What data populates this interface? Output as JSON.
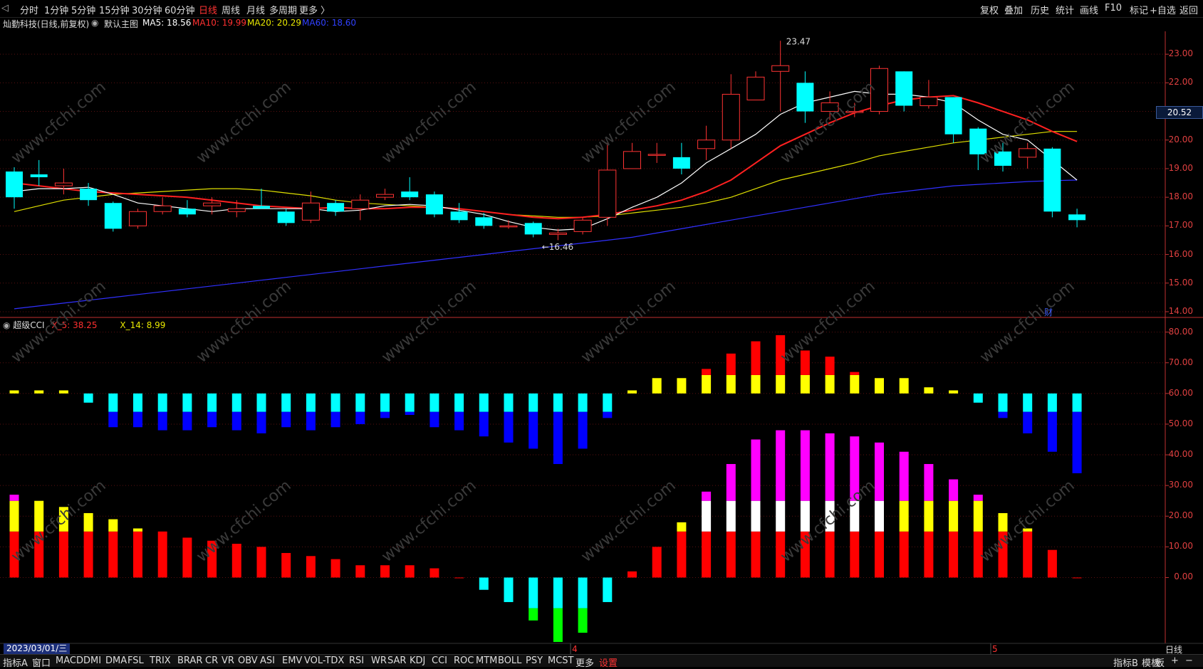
{
  "toolbar": {
    "periods": [
      "分时",
      "1分钟",
      "5分钟",
      "15分钟",
      "30分钟",
      "60分钟",
      "日线",
      "周线",
      "月线",
      "多周期",
      "更多 〉"
    ],
    "active_period": "日线",
    "right_buttons": [
      "复权",
      "叠加",
      "历史",
      "统计",
      "画线",
      "F10",
      "标记",
      "+自选",
      "返回"
    ]
  },
  "main_title": {
    "stock": "灿勤科技(日线,前复权)",
    "template": "默认主图",
    "ma5": "MA5: 18.56",
    "ma10": "MA10: 19.99",
    "ma20": "MA20: 20.29",
    "ma60": "MA60: 18.60"
  },
  "colors": {
    "up": "#ff3333",
    "down": "#00ffff",
    "ma5": "#ffffff",
    "ma10": "#ff2020",
    "ma20": "#e0e000",
    "ma60": "#3030ff",
    "axis": "#c03030",
    "grid": "#5a1010",
    "cci_red": "#ff0000",
    "cci_yellow": "#ffff00",
    "cci_magenta": "#ff00ff",
    "cci_white": "#ffffff",
    "cci_cyan": "#00ffff",
    "cci_green": "#00ff00",
    "cci_blue": "#0000ff"
  },
  "chart_data": [
    {
      "type": "candlestick",
      "title": "灿勤科技(日线,前复权)",
      "ylim": [
        13.8,
        23.8
      ],
      "yticks": [
        "23.00",
        "22.00",
        "21.00",
        "20.00",
        "19.00",
        "18.00",
        "17.00",
        "16.00",
        "15.00",
        "14.00"
      ],
      "ytick_values": [
        23,
        22,
        21,
        20,
        19,
        18,
        17,
        16,
        15,
        14
      ],
      "current_price": "20.52",
      "annotations": {
        "high": "23.47",
        "low": "16.46"
      },
      "candles": [
        [
          18.9,
          18.0,
          19.05,
          17.6
        ],
        [
          18.8,
          18.7,
          19.3,
          18.4
        ],
        [
          18.4,
          18.5,
          19.0,
          18.1
        ],
        [
          18.3,
          17.9,
          18.5,
          17.7
        ],
        [
          17.8,
          16.9,
          17.85,
          16.8
        ],
        [
          17.0,
          17.5,
          17.6,
          16.9
        ],
        [
          17.5,
          17.7,
          18.0,
          17.4
        ],
        [
          17.6,
          17.4,
          17.9,
          17.3
        ],
        [
          17.7,
          17.8,
          18.0,
          17.4
        ],
        [
          17.5,
          17.6,
          17.9,
          17.3
        ],
        [
          17.7,
          17.6,
          18.3,
          17.6
        ],
        [
          17.5,
          17.1,
          17.6,
          17.0
        ],
        [
          17.2,
          17.8,
          18.2,
          17.1
        ],
        [
          17.8,
          17.5,
          17.9,
          17.35
        ],
        [
          17.6,
          17.9,
          18.1,
          17.2
        ],
        [
          18.0,
          18.1,
          18.3,
          17.9
        ],
        [
          18.2,
          18.0,
          18.7,
          17.9
        ],
        [
          18.1,
          17.4,
          18.2,
          17.3
        ],
        [
          17.5,
          17.2,
          17.8,
          17.1
        ],
        [
          17.3,
          17.0,
          17.45,
          16.9
        ],
        [
          17.0,
          17.0,
          17.2,
          16.9
        ],
        [
          17.1,
          16.7,
          17.15,
          16.6
        ],
        [
          16.7,
          16.75,
          16.9,
          16.5
        ],
        [
          16.8,
          17.2,
          17.3,
          16.7
        ],
        [
          17.3,
          18.95,
          19.9,
          17.0
        ],
        [
          19.0,
          19.6,
          19.9,
          19.0
        ],
        [
          19.5,
          19.5,
          19.9,
          19.2
        ],
        [
          19.4,
          19.0,
          19.9,
          18.8
        ],
        [
          19.7,
          20.0,
          20.5,
          19.3
        ],
        [
          20.0,
          21.6,
          22.3,
          19.7
        ],
        [
          21.4,
          22.2,
          22.4,
          21.4
        ],
        [
          22.4,
          22.6,
          23.47,
          21.0
        ],
        [
          22.0,
          21.0,
          22.4,
          20.6
        ],
        [
          21.0,
          21.3,
          21.7,
          20.7
        ],
        [
          21.0,
          21.0,
          21.3,
          20.8
        ],
        [
          21.0,
          22.5,
          22.6,
          20.9
        ],
        [
          22.4,
          21.2,
          22.4,
          21.0
        ],
        [
          21.2,
          21.5,
          22.1,
          21.1
        ],
        [
          21.5,
          20.2,
          21.5,
          19.9
        ],
        [
          20.4,
          19.5,
          20.45,
          18.95
        ],
        [
          19.6,
          19.1,
          19.9,
          18.9
        ],
        [
          19.4,
          19.7,
          19.9,
          19.0
        ],
        [
          19.7,
          17.5,
          19.75,
          17.3
        ],
        [
          17.4,
          17.2,
          17.6,
          16.95
        ]
      ],
      "ma5": [
        18.2,
        18.3,
        18.3,
        18.35,
        18.1,
        17.8,
        17.7,
        17.6,
        17.5,
        17.6,
        17.6,
        17.6,
        17.6,
        17.5,
        17.55,
        17.7,
        17.75,
        17.7,
        17.55,
        17.4,
        17.15,
        16.95,
        16.85,
        16.9,
        17.25,
        17.65,
        18.0,
        18.5,
        19.2,
        19.7,
        20.2,
        20.9,
        21.3,
        21.5,
        21.7,
        21.6,
        21.6,
        21.5,
        21.3,
        20.7,
        20.2,
        20.0,
        19.3,
        18.6
      ],
      "ma10": [
        18.5,
        18.4,
        18.3,
        18.2,
        18.15,
        18.1,
        18.05,
        18.0,
        17.9,
        17.8,
        17.7,
        17.65,
        17.6,
        17.65,
        17.6,
        17.6,
        17.65,
        17.65,
        17.6,
        17.5,
        17.4,
        17.3,
        17.25,
        17.3,
        17.4,
        17.55,
        17.7,
        17.9,
        18.2,
        18.6,
        19.2,
        19.8,
        20.2,
        20.6,
        20.95,
        21.2,
        21.4,
        21.5,
        21.55,
        21.3,
        21.0,
        20.7,
        20.3,
        19.95
      ],
      "ma20": [
        17.5,
        17.7,
        17.9,
        18.0,
        18.1,
        18.15,
        18.2,
        18.25,
        18.3,
        18.3,
        18.25,
        18.15,
        18.05,
        17.9,
        17.8,
        17.75,
        17.7,
        17.65,
        17.6,
        17.5,
        17.4,
        17.35,
        17.3,
        17.3,
        17.35,
        17.45,
        17.55,
        17.65,
        17.8,
        18.0,
        18.3,
        18.6,
        18.8,
        19.0,
        19.2,
        19.45,
        19.6,
        19.75,
        19.9,
        20.0,
        20.1,
        20.2,
        20.3,
        20.3
      ],
      "ma60": [
        14.1,
        14.2,
        14.3,
        14.4,
        14.5,
        14.6,
        14.7,
        14.8,
        14.9,
        15.0,
        15.1,
        15.2,
        15.3,
        15.4,
        15.5,
        15.6,
        15.7,
        15.8,
        15.9,
        16.0,
        16.1,
        16.2,
        16.3,
        16.4,
        16.5,
        16.6,
        16.75,
        16.9,
        17.05,
        17.2,
        17.35,
        17.5,
        17.65,
        17.8,
        17.95,
        18.1,
        18.2,
        18.3,
        18.4,
        18.45,
        18.5,
        18.55,
        18.58,
        18.6
      ]
    },
    {
      "type": "bar",
      "title": "超级CCI",
      "series_labels": {
        "x5": "X_5: 38.25",
        "x14": "X_14: 8.99"
      },
      "ylim": [
        -21,
        82
      ],
      "yticks": [
        "80.00",
        "70.00",
        "60.00",
        "50.00",
        "40.00",
        "30.00",
        "20.00",
        "10.00",
        "0.00"
      ],
      "ytick_values": [
        80,
        70,
        60,
        50,
        40,
        30,
        20,
        10,
        0
      ],
      "upper_baseline": 60,
      "upper": [
        1,
        1,
        1,
        -3,
        -11,
        -11,
        -12,
        -12,
        -11,
        -12,
        -13,
        -11,
        -12,
        -11,
        -10,
        -8,
        -7,
        -11,
        -12,
        -14,
        -16,
        -18,
        -23,
        -18,
        -8,
        1,
        5,
        5,
        8,
        13,
        17,
        19,
        14,
        12,
        7,
        5,
        5,
        2,
        1,
        -3,
        -8,
        -13,
        -19,
        -26
      ],
      "lower": [
        27,
        25,
        23,
        21,
        19,
        16,
        15,
        13,
        12,
        11,
        10,
        8,
        7,
        6,
        4,
        4,
        4,
        3,
        0,
        -4,
        -8,
        -14,
        -21,
        -18,
        -8,
        2,
        10,
        18,
        28,
        37,
        45,
        48,
        48,
        47,
        46,
        44,
        41,
        37,
        32,
        27,
        21,
        16,
        9,
        0
      ]
    }
  ],
  "bottom_tabs": [
    "指标A",
    "窗口",
    "MACD",
    "DMI",
    "DMA",
    "FSL",
    "TRIX",
    "BRAR",
    "CR",
    "VR",
    "OBV",
    "ASI",
    "EMV",
    "VOL-TDX",
    "RSI",
    "WR",
    "SAR",
    "KDJ",
    "CCI",
    "ROC",
    "MTM",
    "BOLL",
    "PSY",
    "MCST",
    "更多",
    "设置"
  ],
  "bottom_right": [
    "指标B",
    "模板",
    "板",
    "+",
    "−"
  ],
  "date_label": "2023/03/01/三",
  "month_marks": [
    "4",
    "5"
  ],
  "period_label": "日线",
  "finance_mark": "财",
  "watermark": "www.cfchi.com"
}
